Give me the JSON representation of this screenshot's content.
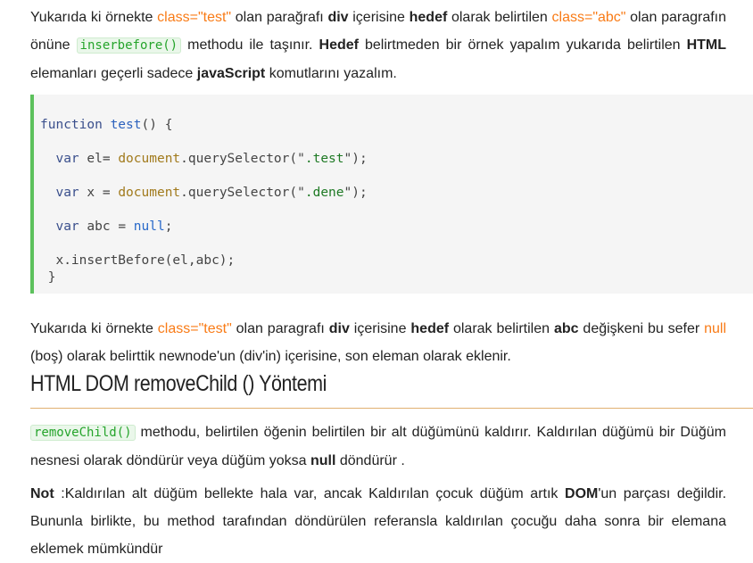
{
  "para1": {
    "t1": "Yukarıda ki örnekte ",
    "o1": "class=\"test\"",
    "t2": " olan parağrafı ",
    "b1": "div",
    "t3": " içerisine ",
    "b2": "hedef",
    "t4": " olarak belirtilen ",
    "o2": "class=\"abc\"",
    "t5": " olan paragrafın önüne ",
    "code": "inserbefore()",
    "t6": " methodu ile taşınır. ",
    "b3": "Hedef",
    "t7": " belirtmeden bir örnek yapalım yukarıda belirtilen ",
    "b4": "HTML",
    "t8": " elemanları geçerli sadece ",
    "b5": "javaScript",
    "t9": " komutlarını yazalım."
  },
  "code": {
    "l1_kw": "function",
    "l1_fn": "test",
    "l1_rest": "() {",
    "l2_kw": "var",
    "l2_a": " el= ",
    "l2_doc": "document",
    "l2_b": ".querySelector(\"",
    "l2_str": ".test",
    "l2_c": "\");",
    "l3_kw": "var",
    "l3_a": " x = ",
    "l3_doc": "document",
    "l3_b": ".querySelector(\"",
    "l3_str": ".dene",
    "l3_c": "\");",
    "l4_kw": "var",
    "l4_a": " abc = ",
    "l4_null": "null",
    "l4_b": ";",
    "l5": "x.insertBefore(el,abc);",
    "l6": "}"
  },
  "para2": {
    "t1": "Yukarıda ki örnekte ",
    "o1": "class=\"test\"",
    "t2": " olan paragrafı ",
    "b1": "div",
    "t3": " içerisine ",
    "b2": "hedef",
    "t4": " olarak belirtilen ",
    "b3": "abc",
    "t5": " değişkeni bu sefer ",
    "o2": "null",
    "t6": " (boş) olarak belirttik newnode'un (div'in) içerisine, son eleman olarak eklenir."
  },
  "heading": "HTML DOM removeChild () Yöntemi",
  "para3": {
    "code": "removeChild()",
    "t1": " methodu, belirtilen öğenin belirtilen bir alt düğümünü kaldırır. Kaldırılan düğümü bir Düğüm nesnesi olarak döndürür veya düğüm yoksa ",
    "b1": "null",
    "t2": " döndürür ."
  },
  "para4": {
    "b1": "Not",
    "t1": " :Kaldırılan alt düğüm bellekte hala var, ancak Kaldırılan çocuk düğüm artık ",
    "b2": "DOM",
    "t2": "'un parçası değildir. Bununla birlikte, bu method tarafından döndürülen referansla kaldırılan çocuğu daha sonra bir elemana eklemek mümkündür"
  }
}
